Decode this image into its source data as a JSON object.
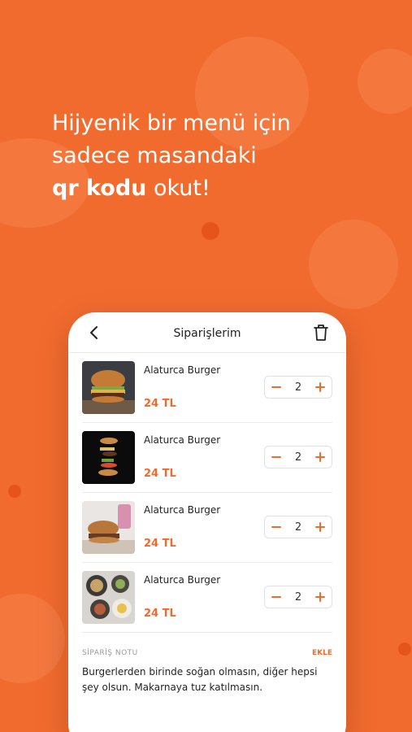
{
  "headline": {
    "line1": "Hijyenik bir menü için",
    "line2": "sadece masandaki",
    "line3_bold": "qr kodu",
    "line3_rest": " okut!"
  },
  "screen": {
    "title": "Siparişlerim",
    "back_icon": "chevron-left-icon",
    "trash_icon": "trash-icon"
  },
  "cart": {
    "items": [
      {
        "name": "Alaturca Burger",
        "price": "24 TL",
        "qty": "2"
      },
      {
        "name": "Alaturca Burger",
        "price": "24 TL",
        "qty": "2"
      },
      {
        "name": "Alaturca Burger",
        "price": "24 TL",
        "qty": "2"
      },
      {
        "name": "Alaturca Burger",
        "price": "24 TL",
        "qty": "2"
      }
    ]
  },
  "note": {
    "label": "SİPARİŞ NOTU",
    "add_label": "EKLE",
    "text": "Burgerlerden birinde soğan olmasın, diğer hepsi şey olsun. Makarnaya tuz katılmasın."
  },
  "colors": {
    "background": "#f26b2e",
    "accent": "#f06a2c"
  }
}
